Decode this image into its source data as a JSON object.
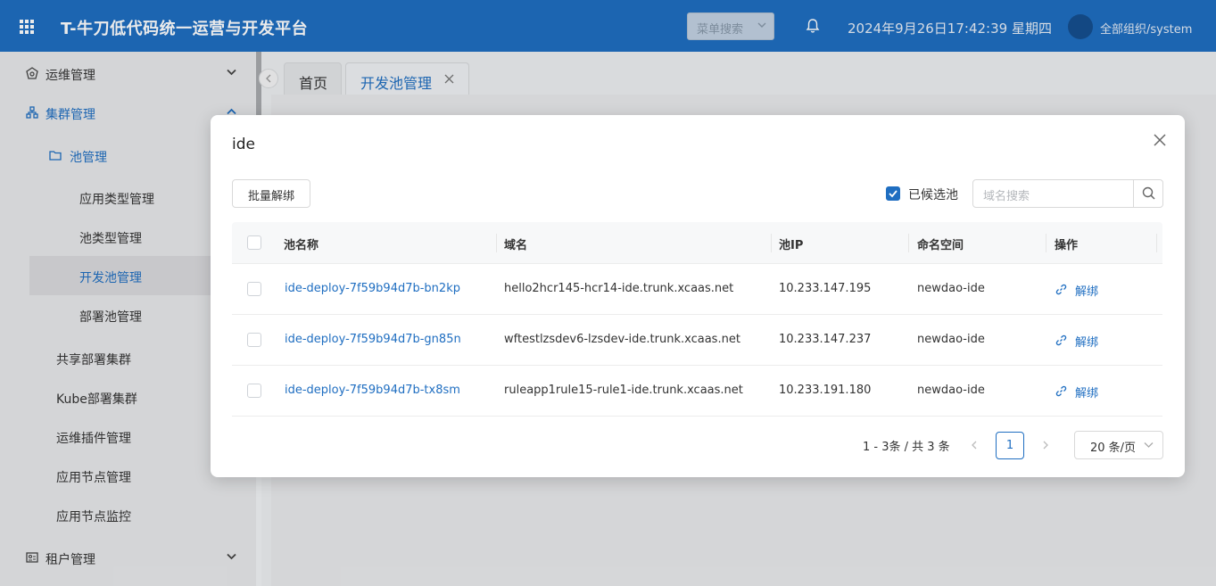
{
  "header": {
    "app_title": "T-牛刀低代码统一运营与开发平台",
    "menu_search_placeholder": "菜单搜索",
    "datetime": "2024年9月26日17:42:39 星期四",
    "org_user": "全部组织/system"
  },
  "sidebar": {
    "items": [
      {
        "label": "运维管理",
        "icon": "ops-icon"
      },
      {
        "label": "集群管理",
        "icon": "cluster-icon"
      },
      {
        "label": "池管理",
        "icon": "folder-icon"
      },
      {
        "label": "应用类型管理"
      },
      {
        "label": "池类型管理"
      },
      {
        "label": "开发池管理"
      },
      {
        "label": "部署池管理"
      },
      {
        "label": "共享部署集群"
      },
      {
        "label": "Kube部署集群"
      },
      {
        "label": "运维插件管理"
      },
      {
        "label": "应用节点管理"
      },
      {
        "label": "应用节点监控"
      },
      {
        "label": "租户管理",
        "icon": "tenant-icon"
      }
    ]
  },
  "tabs": [
    {
      "label": "首页"
    },
    {
      "label": "开发池管理"
    }
  ],
  "modal": {
    "title": "ide",
    "batch_unbind_label": "批量解绑",
    "candidate_pool_label": "已候选池",
    "candidate_pool_checked": true,
    "domain_search_placeholder": "域名搜索",
    "columns": [
      "池名称",
      "域名",
      "池IP",
      "命名空间",
      "操作"
    ],
    "rows": [
      {
        "pool_name": "ide-deploy-7f59b94d7b-bn2kp",
        "domain": "hello2hcr145-hcr14-ide.trunk.xcaas.net",
        "pool_ip": "10.233.147.195",
        "namespace": "newdao-ide",
        "action": "解绑"
      },
      {
        "pool_name": "ide-deploy-7f59b94d7b-gn85n",
        "domain": "wftestlzsdev6-lzsdev-ide.trunk.xcaas.net",
        "pool_ip": "10.233.147.237",
        "namespace": "newdao-ide",
        "action": "解绑"
      },
      {
        "pool_name": "ide-deploy-7f59b94d7b-tx8sm",
        "domain": "ruleapp1rule15-rule1-ide.trunk.xcaas.net",
        "pool_ip": "10.233.191.180",
        "namespace": "newdao-ide",
        "action": "解绑"
      }
    ],
    "pagination": {
      "total_text": "1 - 3条 / 共 3 条",
      "current_page": "1",
      "page_size": "20 条/页"
    }
  },
  "colors": {
    "primary": "#1f6ec1",
    "header_bg": "#1f6ec1"
  }
}
